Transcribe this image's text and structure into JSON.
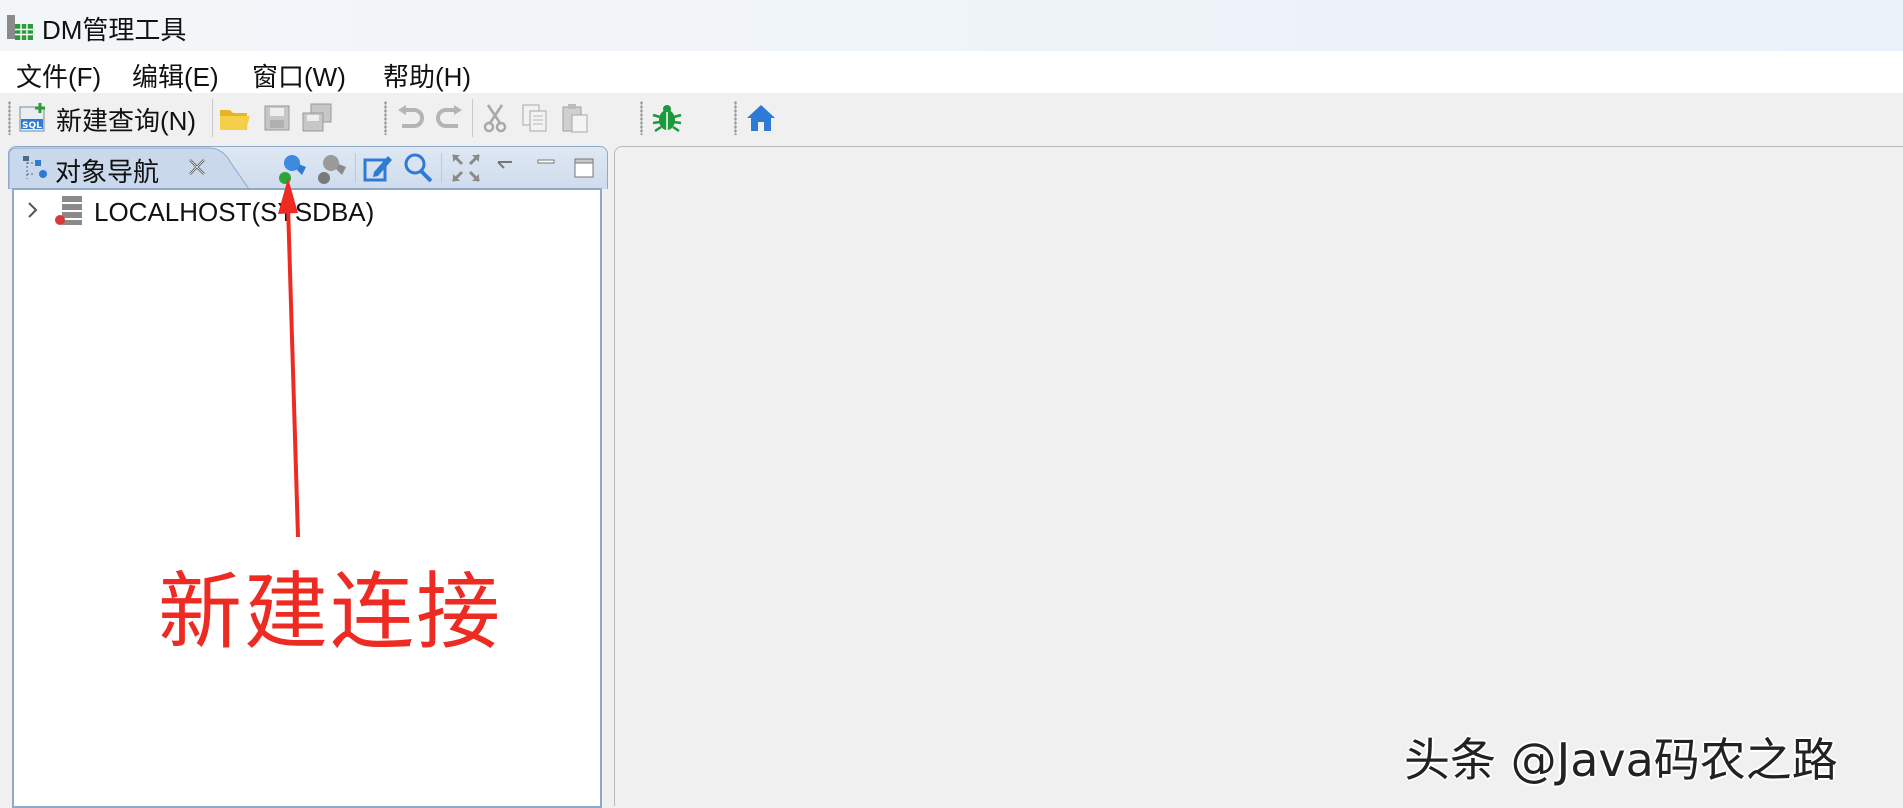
{
  "window": {
    "title": "DM管理工具",
    "icon": "database-grid-icon"
  },
  "menubar": {
    "items": [
      {
        "label": "文件(F)"
      },
      {
        "label": "编辑(E)"
      },
      {
        "label": "窗口(W)"
      },
      {
        "label": "帮助(H)"
      }
    ]
  },
  "toolbar": {
    "new_query_label": "新建查询(N)",
    "icons": [
      "sql-new-icon",
      "open-folder-icon",
      "save-icon",
      "save-all-icon",
      "undo-icon",
      "redo-icon",
      "cut-icon",
      "copy-icon",
      "paste-icon",
      "debug-bug-icon",
      "home-icon"
    ]
  },
  "navigator": {
    "tab_label": "对象导航",
    "toolbar_icons": [
      "new-connection-icon",
      "disconnect-icon",
      "edit-icon",
      "search-icon",
      "expand-all-icon",
      "view-menu-icon",
      "minimize-icon",
      "maximize-icon"
    ],
    "tree": [
      {
        "label": "LOCALHOST(SYSDBA)",
        "expanded": false,
        "icon": "database-server-icon"
      }
    ]
  },
  "annotation": {
    "text": "新建连接",
    "color": "#ee2b22"
  },
  "watermark": {
    "text": "头条 @Java码农之路"
  },
  "colors": {
    "accent_blue": "#2e7bd6",
    "annotation_red": "#ee2b22",
    "bug_green": "#1a9a3a"
  }
}
